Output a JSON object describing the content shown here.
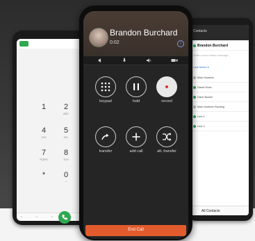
{
  "call": {
    "caller_name": "Brandon Burchard",
    "duration": "0:02",
    "buttons": [
      {
        "label": "keypad",
        "icon": "keypad-icon"
      },
      {
        "label": "hold",
        "icon": "pause-icon"
      },
      {
        "label": "record",
        "icon": "record-icon"
      },
      {
        "label": "transfer",
        "icon": "transfer-icon"
      },
      {
        "label": "add call",
        "icon": "plus-icon"
      },
      {
        "label": "att. transfer",
        "icon": "attended-transfer-icon"
      }
    ],
    "end_call_label": "End Call",
    "end_call_color": "#e15b2d"
  },
  "dialer": {
    "keys": [
      {
        "digit": "1",
        "letters": ""
      },
      {
        "digit": "2",
        "letters": "ABC"
      },
      {
        "digit": "4",
        "letters": "GHI"
      },
      {
        "digit": "5",
        "letters": "JKL"
      },
      {
        "digit": "7",
        "letters": "PQRS"
      },
      {
        "digit": "8",
        "letters": "TUV"
      },
      {
        "digit": "*",
        "letters": ""
      },
      {
        "digit": "0",
        "letters": "+"
      }
    ],
    "call_button_color": "#2fa84f"
  },
  "contacts": {
    "header": "Contacts",
    "my_name": "Brandon Burchard",
    "status_placeholder": "Enter a new status message...",
    "filter_label": "Last Name",
    "items": [
      "Main Number",
      "David Rose",
      "Dave Boartz",
      "Main Number Routing",
      "Line 1",
      "Line 2"
    ],
    "footer": "All Contacts",
    "presence_color": "#2fa84f"
  }
}
